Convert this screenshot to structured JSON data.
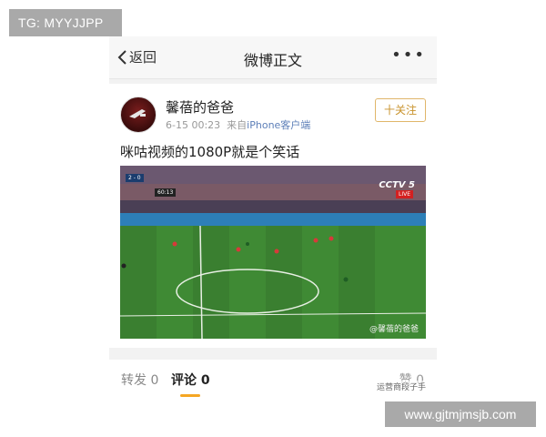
{
  "overlay": {
    "tg_label": "TG: MYYJJPP",
    "site_label": "www.gjtmjmsjb.com"
  },
  "nav": {
    "back_label": "返回",
    "title": "微博正文",
    "more_icon": "more-dots-icon"
  },
  "post": {
    "username": "馨蓓的爸爸",
    "timestamp": "6-15 00:23",
    "source_prefix": "来自",
    "source": "iPhone客户端",
    "follow_label": "十关注",
    "text": "咪咕视频的1080P就是个笑话",
    "video": {
      "watermark": "@馨蓓的爸爸",
      "broadcaster": "CCTV 5",
      "live_label": "LIVE",
      "score": "2 - 0",
      "clock": "60:13"
    }
  },
  "tabs": {
    "repost": "转发 0",
    "comments": "评论 0",
    "likes": "赞 0",
    "wechat_watermark": "运营商段子手"
  },
  "colors": {
    "follow_accent": "#c8922b",
    "tab_underline": "#f5a623",
    "pitch_green": "#3b7b33"
  }
}
